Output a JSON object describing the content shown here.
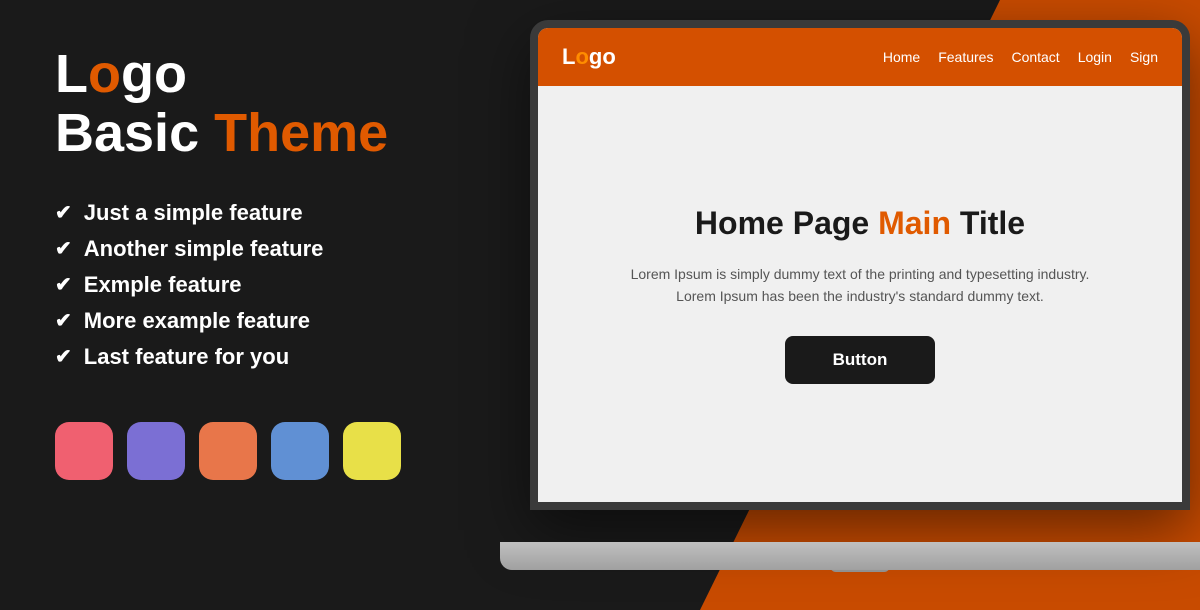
{
  "background": {
    "color": "#1a1a1a",
    "accent_color": "#c84b00"
  },
  "left_panel": {
    "logo": {
      "text_white": "Logo",
      "text_orange": "o",
      "full_text": "Logo"
    },
    "subtitle": {
      "text_white": "Basic ",
      "text_orange": "Theme",
      "full_text": "Basic Theme"
    },
    "features": [
      {
        "label": "Just a simple feature"
      },
      {
        "label": "Another simple feature"
      },
      {
        "label": "Exmple feature"
      },
      {
        "label": "More example feature"
      },
      {
        "label": "Last feature for you"
      }
    ],
    "swatches": [
      {
        "name": "pink",
        "color": "#f06070"
      },
      {
        "name": "purple",
        "color": "#7b6fd4"
      },
      {
        "name": "salmon",
        "color": "#e8764a"
      },
      {
        "name": "blue",
        "color": "#6090d4"
      },
      {
        "name": "yellow",
        "color": "#e8e048"
      }
    ]
  },
  "preview": {
    "navbar": {
      "logo_white": "L",
      "logo_orange": "ogo",
      "logo_full": "Logo",
      "nav_links": [
        "Home",
        "Features",
        "Contact",
        "Login",
        "Sign"
      ]
    },
    "hero": {
      "title_black": "Home Page ",
      "title_orange": "Main",
      "title_end": " Title",
      "full_title": "Home Page Main Title",
      "description": "Lorem Ipsum is simply dummy text of the printing and typesetting industry. Lorem Ipsum has been the industry's standard dummy text.",
      "button_label": "Button"
    }
  }
}
